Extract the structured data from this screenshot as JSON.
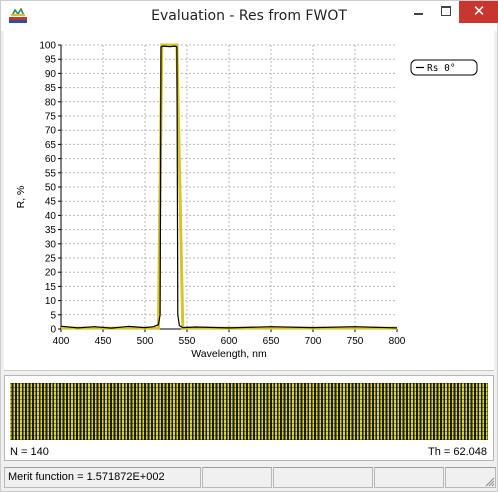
{
  "window": {
    "title": "Evaluation - Res from FWOT",
    "close_glyph": "✕",
    "icons": {
      "app": "app-icon",
      "minimize": "minimize-icon",
      "maximize": "maximize-icon",
      "close": "close-icon"
    }
  },
  "chart_data": {
    "type": "line",
    "title": "",
    "xlabel": "Wavelength, nm",
    "ylabel": "R, %",
    "xlim": [
      400,
      800
    ],
    "ylim": [
      0,
      100
    ],
    "x_ticks": [
      400,
      450,
      500,
      550,
      600,
      650,
      700,
      750,
      800
    ],
    "y_ticks": [
      0,
      5,
      10,
      15,
      20,
      25,
      30,
      35,
      40,
      45,
      50,
      55,
      60,
      65,
      70,
      75,
      80,
      85,
      90,
      95,
      100
    ],
    "grid": true,
    "legend_position": "top-right",
    "series": [
      {
        "name": "Rs 0°",
        "color": "#000000",
        "x": [
          400,
          420,
          440,
          460,
          480,
          500,
          510,
          516,
          518,
          519,
          521,
          525,
          530,
          535,
          537,
          538,
          539,
          541,
          545,
          560,
          600,
          650,
          700,
          750,
          800
        ],
        "y": [
          1,
          0.4,
          0.8,
          0.3,
          0.9,
          0.5,
          0.8,
          1.5,
          5,
          99.3,
          99.6,
          99.5,
          99.4,
          99.6,
          99.5,
          99.3,
          5,
          1.2,
          0.5,
          0.7,
          0.4,
          0.8,
          0.5,
          0.8,
          0.4
        ]
      },
      {
        "name": "",
        "color": "#d4c628",
        "x": [
          400,
          500,
          516,
          520,
          530,
          538,
          545,
          600,
          700,
          800
        ],
        "y": [
          0.3,
          0.3,
          0.3,
          100,
          100,
          100,
          0.3,
          0.3,
          0.3,
          0.3
        ]
      }
    ]
  },
  "layer_panel": {
    "n_label": "N = 140",
    "th_label": "Th = 62.048"
  },
  "status": {
    "merit": "Merit function =  1.571872E+002",
    "cell2": "",
    "cell3": "",
    "cell4": "",
    "cell5": ""
  }
}
